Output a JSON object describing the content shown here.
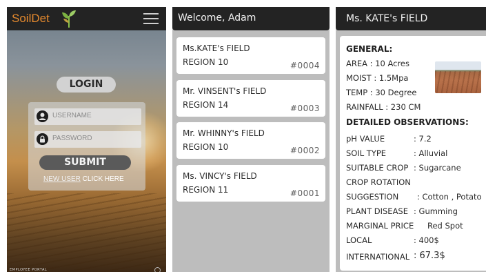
{
  "login_screen": {
    "brand": "SoilDet",
    "login_label": "LOGIN",
    "username_placeholder": "USERNAME",
    "password_placeholder": "PASSWORD",
    "submit_label": "SUBMIT",
    "new_user_link": "NEW USER",
    "click_here": " CLICK HERE",
    "footer": "EMPLOYEE PORTAL"
  },
  "list_screen": {
    "title": "Welcome, Adam",
    "fields": [
      {
        "name": "Ms.KATE's FIELD",
        "region": "REGION 10",
        "id": "#0004"
      },
      {
        "name": "Mr. VINSENT's FIELD",
        "region": "REGION 14",
        "id": "#0003"
      },
      {
        "name": "Mr. WHINNY's FIELD",
        "region": "REGION 10",
        "id": "#0002"
      },
      {
        "name": "Ms. VINCY's FIELD",
        "region": "REGION 11",
        "id": "#0001"
      }
    ]
  },
  "detail_screen": {
    "title": "Ms. KATE's FIELD",
    "general_heading": "GENERAL:",
    "area": "AREA  : 10 Acres",
    "moist": "MOIST : 1.5Mpa",
    "temp": "TEMP  : 30 Degree",
    "rainfall": "RAINFALL : 230 CM",
    "detailed_heading": "DETAILED OBSERVATIONS:",
    "ph_label": "pH VALUE",
    "ph_value": ":  7.2",
    "soil_label": "SOIL TYPE",
    "soil_value": ":  Alluvial",
    "crop_label": "SUITABLE CROP",
    "crop_value": ":  Sugarcane",
    "rotation_label": "CROP ROTATION",
    "suggestion_label": "SUGGESTION",
    "suggestion_value": ": Cotton , Potato",
    "disease_label": "PLANT DISEASE",
    "disease_value": ":  Gumming",
    "marginal_label": "MARGINAL PRICE",
    "marginal_value": "Red Spot",
    "local_label": "LOCAL",
    "local_value": ":  400$",
    "international_label": "INTERNATIONAL",
    "international_value": ":  67.3$"
  },
  "colors": {
    "header_bg": "#232323",
    "brand_orange": "#e68a2e",
    "panel_gray": "#bdbdbd"
  },
  "icons": [
    "sprout-logo-icon",
    "hamburger-menu-icon",
    "user-icon",
    "lock-icon"
  ]
}
